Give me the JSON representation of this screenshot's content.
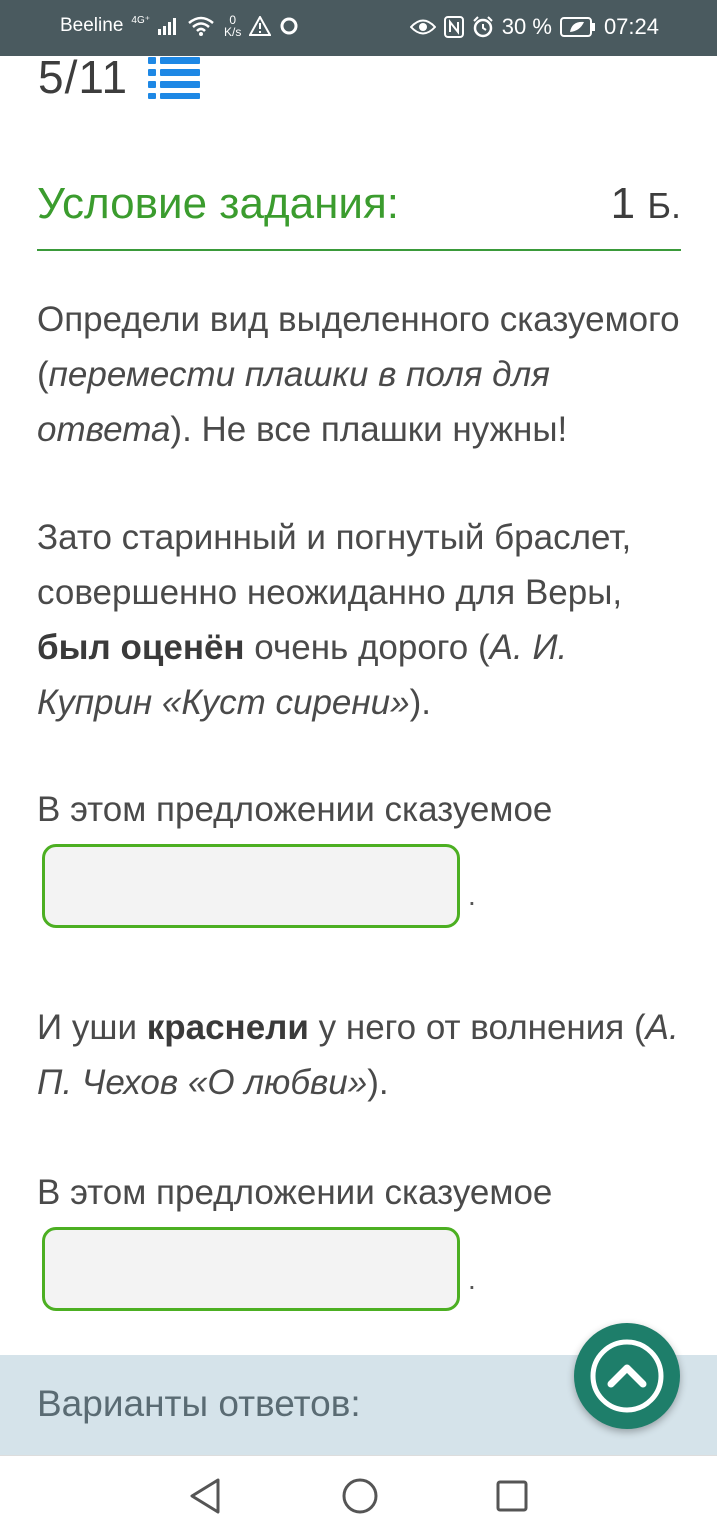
{
  "status_bar": {
    "carrier": "Beeline",
    "network_gen": "4G⁺",
    "speed_value": "0",
    "speed_unit": "K/s",
    "battery": "30 %",
    "time": "07:24",
    "text_color": "#ffffff",
    "background": "#4a5a5f"
  },
  "task": {
    "counter": "5/11",
    "list_icon": "list-icon",
    "accent_color": "#1e88e5"
  },
  "header": {
    "title": "Условие задания:",
    "score": "1",
    "score_unit": "Б.",
    "title_color": "#3b9c2e"
  },
  "instruction": {
    "text_a": "Определи вид выделенного сказуемого (",
    "italic": "перемести плашки в поля для ответа",
    "text_b": "). Не все плашки нужны!"
  },
  "sentence1": {
    "pre": "Зато старинный и погнутый браслет, совершенно неожиданно для Веры, ",
    "bold": "был оценён",
    "post": " очень дорого (",
    "source": "А. И. Куприн «Куст сирени»",
    "end": ")."
  },
  "prompt1": "В этом предложении сказуемое",
  "drop1_value": "",
  "drop1_dot": ".",
  "sentence2": {
    "pre": "И уши ",
    "bold": "краснели",
    "post": " у него от волнения (",
    "source": "А. П. Чехов «О любви»",
    "end": ")."
  },
  "prompt2": "В этом предложении сказуемое",
  "drop2_value": "",
  "drop2_dot": ".",
  "variants": {
    "label": "Варианты ответов:",
    "background": "#d5e3ea"
  },
  "scroll_button": {
    "icon": "chevron-up-icon",
    "color": "#1e7e6a"
  },
  "nav_bar": {
    "back_icon": "back-triangle-icon",
    "home_icon": "home-circle-icon",
    "recent_icon": "recent-square-icon"
  }
}
